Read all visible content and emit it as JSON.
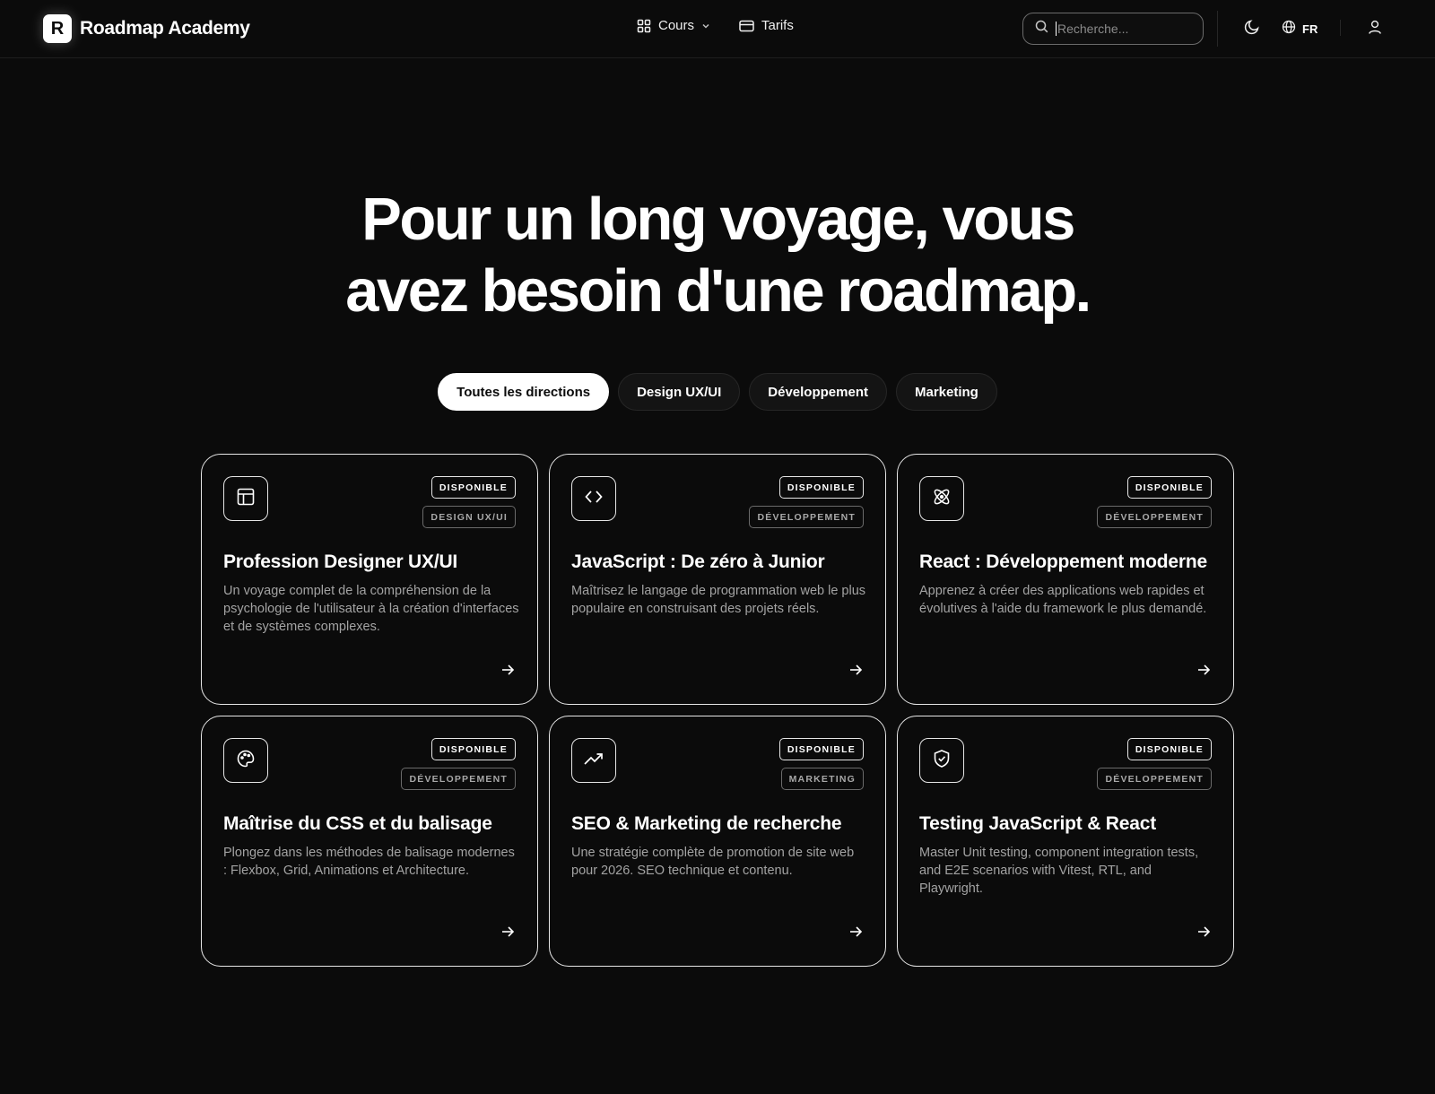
{
  "brand": {
    "logo_letter": "R",
    "name": "Roadmap Academy"
  },
  "nav": {
    "courses": {
      "label": "Cours",
      "icon": "grid-icon"
    },
    "pricing": {
      "label": "Tarifs",
      "icon": "credit-card-icon"
    }
  },
  "search": {
    "placeholder": "Recherche...",
    "value": ""
  },
  "language": {
    "label": "FR"
  },
  "hero": {
    "line1": "Pour un long voyage, vous",
    "line2": "avez besoin d'une roadmap."
  },
  "filters": [
    {
      "label": "Toutes les directions",
      "active": true
    },
    {
      "label": "Design UX/UI",
      "active": false
    },
    {
      "label": "Développement",
      "active": false
    },
    {
      "label": "Marketing",
      "active": false
    }
  ],
  "courses": [
    {
      "icon": "layout-icon",
      "status": "DISPONIBLE",
      "category": "DESIGN UX/UI",
      "title": "Profession Designer UX/UI",
      "description": "Un voyage complet de la compréhension de la psychologie de l'utilisateur à la création d'interfaces et de systèmes complexes."
    },
    {
      "icon": "code-icon",
      "status": "DISPONIBLE",
      "category": "DÉVELOPPEMENT",
      "title": "JavaScript : De zéro à Junior",
      "description": "Maîtrisez le langage de programmation web le plus populaire en construisant des projets réels."
    },
    {
      "icon": "atom-icon",
      "status": "DISPONIBLE",
      "category": "DÉVELOPPEMENT",
      "title": "React : Développement moderne",
      "description": "Apprenez à créer des applications web rapides et évolutives à l'aide du framework le plus demandé."
    },
    {
      "icon": "palette-icon",
      "status": "DISPONIBLE",
      "category": "DÉVELOPPEMENT",
      "title": "Maîtrise du CSS et du balisage",
      "description": "Plongez dans les méthodes de balisage modernes : Flexbox, Grid, Animations et Architecture."
    },
    {
      "icon": "trending-up-icon",
      "status": "DISPONIBLE",
      "category": "MARKETING",
      "title": "SEO & Marketing de recherche",
      "description": "Une stratégie complète de promotion de site web pour 2026. SEO technique et contenu."
    },
    {
      "icon": "shield-check-icon",
      "status": "DISPONIBLE",
      "category": "DÉVELOPPEMENT",
      "title": "Testing JavaScript & React",
      "description": "Master Unit testing, component integration tests, and E2E scenarios with Vitest, RTL, and Playwright."
    }
  ]
}
